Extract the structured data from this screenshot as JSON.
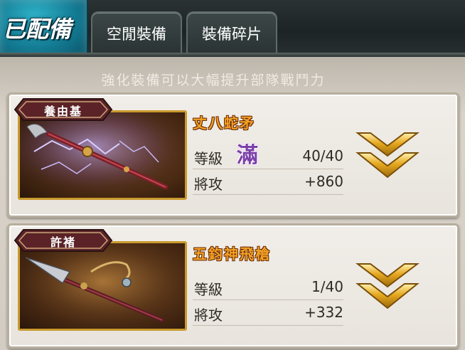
{
  "tabs": {
    "active_label": "已配備",
    "idle_label": "空閒裝備",
    "shards_label": "裝備碎片"
  },
  "hint": "強化裝備可以大幅提升部隊戰鬥力",
  "equipment": [
    {
      "owner": "養由基",
      "name": "丈八蛇矛",
      "level_label": "等級",
      "max_badge": "滿",
      "level": "40/40",
      "attack_label": "將攻",
      "attack": "+860"
    },
    {
      "owner": "許褚",
      "name": "五鈞神飛槍",
      "level_label": "等級",
      "level": "1/40",
      "attack_label": "將攻",
      "attack": "+332"
    }
  ],
  "colors": {
    "accent_teal": "#137c94",
    "gold": "#e6a820",
    "name_orange": "#f2a126",
    "max_purple": "#7b3fa8"
  },
  "icons": [
    "chevron-down-icon",
    "owner-tag-icon"
  ]
}
